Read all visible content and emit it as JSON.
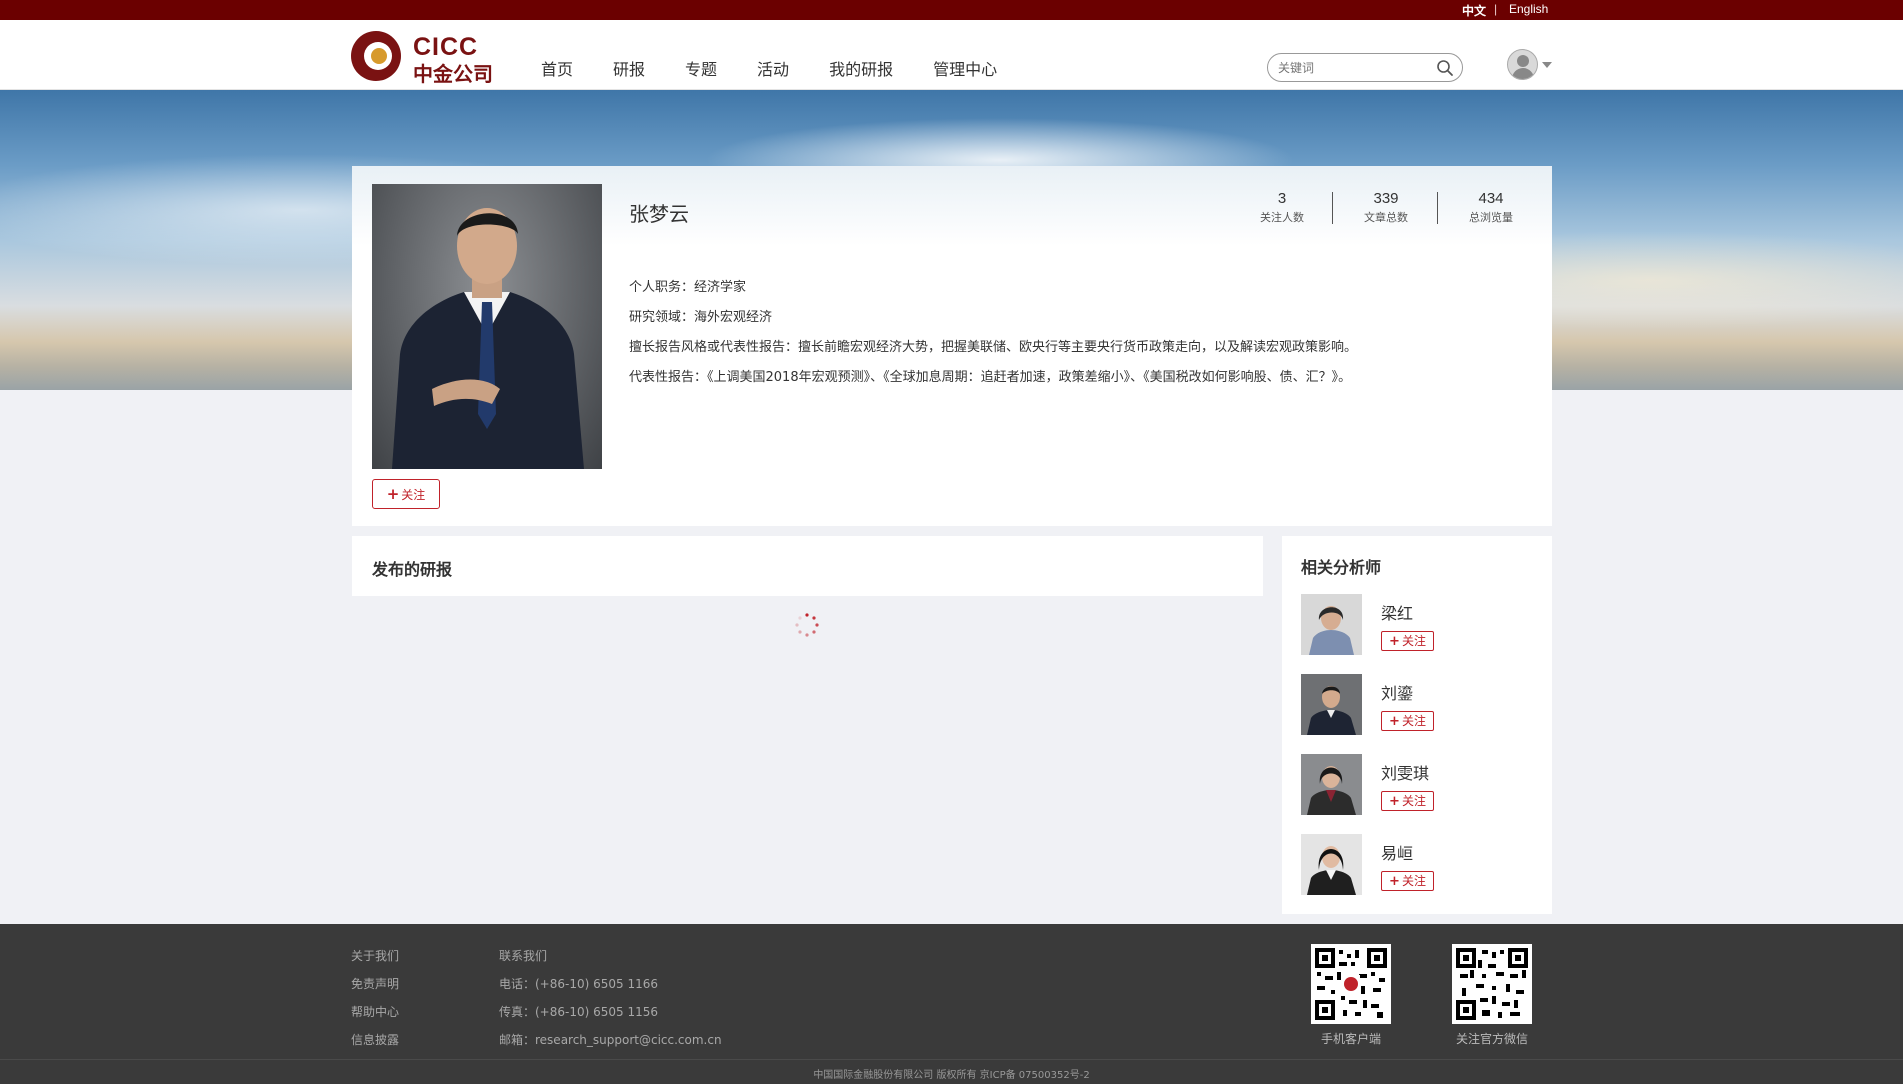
{
  "lang": {
    "cn": "中文",
    "sep": "|",
    "en": "English"
  },
  "logo": {
    "en": "CICC",
    "cn": "中金公司"
  },
  "nav": [
    "首页",
    "研报",
    "专题",
    "活动",
    "我的研报",
    "管理中心"
  ],
  "search": {
    "placeholder": "关键词"
  },
  "profile": {
    "name": "张梦云",
    "follow_label": "关注",
    "stats": [
      {
        "value": "3",
        "label": "关注人数"
      },
      {
        "value": "339",
        "label": "文章总数"
      },
      {
        "value": "434",
        "label": "总浏览量"
      }
    ],
    "info": [
      "个人职务：经济学家",
      "研究领域：海外宏观经济",
      "擅长报告风格或代表性报告：擅长前瞻宏观经济大势，把握美联储、欧央行等主要央行货币政策走向，以及解读宏观政策影响。",
      "代表性报告：《上调美国2018年宏观预测》、《全球加息周期：追赶者加速，政策差缩小》、《美国税改如何影响股、债、汇？》。"
    ]
  },
  "research": {
    "title": "发布的研报"
  },
  "related": {
    "title": "相关分析师",
    "follow_label": "关注",
    "analysts": [
      {
        "name": "梁红"
      },
      {
        "name": "刘鎏"
      },
      {
        "name": "刘雯琪"
      },
      {
        "name": "易峘"
      }
    ]
  },
  "footer": {
    "col1": [
      "关于我们",
      "免责声明",
      "帮助中心",
      "信息披露"
    ],
    "col2": [
      "联系我们",
      "电话：(+86-10) 6505 1166",
      "传真：(+86-10) 6505 1156",
      "邮箱：research_support@cicc.com.cn"
    ],
    "qr1_caption": "手机客户端",
    "qr2_caption": "关注官方微信",
    "copyright": "中国国际金融股份有限公司 版权所有 京ICP备 07500352号-2"
  },
  "colors": {
    "brand": "#6b0000",
    "accent": "#c0222a",
    "footer_bg": "#3a3a3a"
  }
}
